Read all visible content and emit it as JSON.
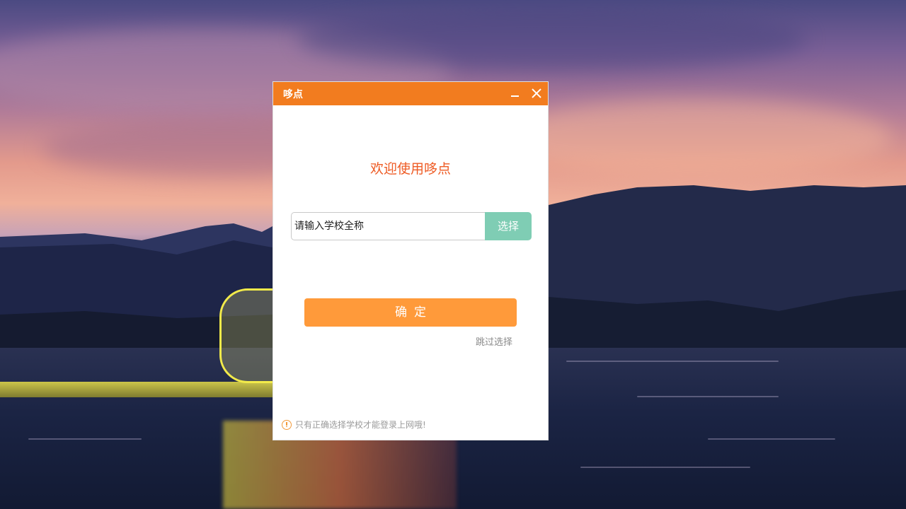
{
  "window": {
    "title": "哆点",
    "minimize_icon": "minimize-icon",
    "close_icon": "close-icon"
  },
  "main": {
    "welcome_text": "欢迎使用哆点",
    "school_input_placeholder": "请输入学校全称",
    "school_input_value": "",
    "select_button_label": "选择",
    "confirm_button_label": "确定",
    "skip_link_label": "跳过选择",
    "notice_icon": "info-icon",
    "notice_text": "只有正确选择学校才能登录上网哦!"
  },
  "colors": {
    "titlebar": "#f27c1f",
    "welcome": "#ee5b24",
    "select_button": "#7fcdb4",
    "confirm_button": "#ff9a3a"
  }
}
